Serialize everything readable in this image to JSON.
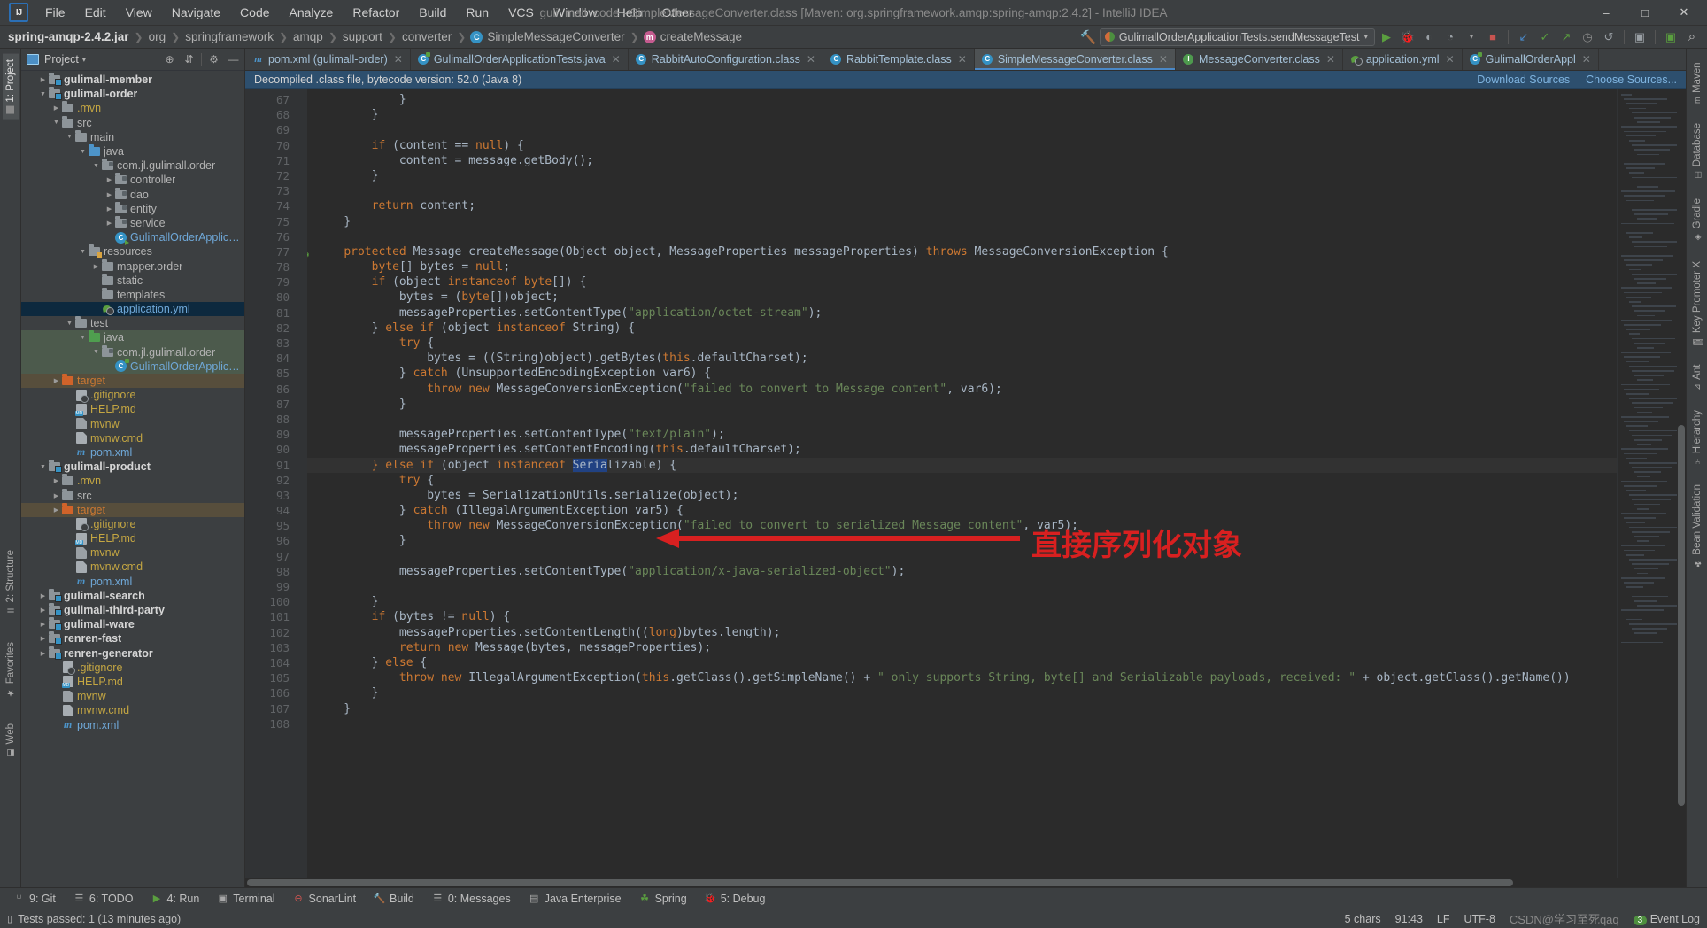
{
  "window": {
    "title": "guli_mall_code - SimpleMessageConverter.class [Maven: org.springframework.amqp:spring-amqp:2.4.2] - IntelliJ IDEA",
    "logo": "IJ",
    "minimize": "–",
    "maximize": "□",
    "close": "✕"
  },
  "menu": [
    {
      "label": "File"
    },
    {
      "label": "Edit"
    },
    {
      "label": "View"
    },
    {
      "label": "Navigate"
    },
    {
      "label": "Code"
    },
    {
      "label": "Analyze"
    },
    {
      "label": "Refactor"
    },
    {
      "label": "Build"
    },
    {
      "label": "Run"
    },
    {
      "label": "VCS"
    },
    {
      "label": "Window"
    },
    {
      "label": "Help"
    },
    {
      "label": "Other"
    }
  ],
  "breadcrumb": [
    {
      "label": "spring-amqp-2.4.2.jar",
      "bold": true,
      "icon": ""
    },
    {
      "label": "org",
      "bold": false,
      "icon": ""
    },
    {
      "label": "springframework",
      "bold": false,
      "icon": ""
    },
    {
      "label": "amqp",
      "bold": false,
      "icon": ""
    },
    {
      "label": "support",
      "bold": false,
      "icon": ""
    },
    {
      "label": "converter",
      "bold": false,
      "icon": ""
    },
    {
      "label": "SimpleMessageConverter",
      "bold": false,
      "icon": "class-icon"
    },
    {
      "label": "createMessage",
      "bold": false,
      "icon": "method-icon"
    }
  ],
  "run_config": {
    "name": "GulimallOrderApplicationTests.sendMessageTest",
    "dropdown_caret": "▾"
  },
  "toolbar_icons": [
    {
      "name": "run-icon",
      "glyph": "▶",
      "color": "#5a9e3f"
    },
    {
      "name": "debug-icon",
      "glyph": "🐞",
      "color": "#5a9e3f"
    },
    {
      "name": "run-with-coverage-icon",
      "glyph": "◐",
      "color": "#9aa0a5"
    },
    {
      "name": "profiler-icon",
      "glyph": "◔",
      "color": "#9aa0a5"
    },
    {
      "name": "stop-icon",
      "glyph": "■",
      "color": "#c75450"
    },
    {
      "name": "step-into-icon",
      "glyph": "↙",
      "color": "#4a88c7"
    },
    {
      "name": "check-icon",
      "glyph": "✓",
      "color": "#5a9e3f"
    },
    {
      "name": "step-out-icon",
      "glyph": "↗",
      "color": "#5a9e3f"
    },
    {
      "name": "history-icon",
      "glyph": "◷",
      "color": "#8b8b8b"
    },
    {
      "name": "undo-icon",
      "glyph": "↺",
      "color": "#9aa0a5"
    },
    {
      "name": "project-structure-icon",
      "glyph": "▣",
      "color": "#9aa0a5"
    },
    {
      "name": "terminal-icon",
      "glyph": "▣",
      "color": "#5a9e3f"
    },
    {
      "name": "search-everywhere-icon",
      "glyph": "⌕",
      "color": "#bbbbbb"
    }
  ],
  "left_strip": {
    "tabs": [
      {
        "label": "1: Project",
        "active": true
      },
      {
        "label": "2: Structure",
        "active": false
      },
      {
        "label": "Favorites",
        "active": false
      },
      {
        "label": "Web",
        "active": false
      }
    ]
  },
  "right_strip": {
    "tabs": [
      {
        "label": "Maven"
      },
      {
        "label": "Database"
      },
      {
        "label": "Gradle"
      },
      {
        "label": "Key Promoter X"
      },
      {
        "label": "Ant"
      },
      {
        "label": "Hierarchy"
      },
      {
        "label": "Bean Validation"
      }
    ]
  },
  "project_panel": {
    "title": "Project",
    "caret": "▾",
    "actions": [
      {
        "name": "locate-icon",
        "glyph": "⊕"
      },
      {
        "name": "collapse-all-icon",
        "glyph": "⇵"
      },
      {
        "name": "settings-icon",
        "glyph": "⚙"
      },
      {
        "name": "hide-icon",
        "glyph": "—"
      }
    ],
    "tree": [
      {
        "depth": 1,
        "arrow": "▶",
        "icon": "module-folder",
        "label": "gulimall-member",
        "style": "bold",
        "row": ""
      },
      {
        "depth": 1,
        "arrow": "▼",
        "icon": "module-folder",
        "label": "gulimall-order",
        "style": "bold",
        "row": ""
      },
      {
        "depth": 2,
        "arrow": "▶",
        "icon": "folder-grey",
        "label": ".mvn",
        "style": "yellow",
        "row": ""
      },
      {
        "depth": 2,
        "arrow": "▼",
        "icon": "folder-grey",
        "label": "src",
        "style": "grey",
        "row": ""
      },
      {
        "depth": 3,
        "arrow": "▼",
        "icon": "folder-grey",
        "label": "main",
        "style": "grey",
        "row": ""
      },
      {
        "depth": 4,
        "arrow": "▼",
        "icon": "folder-blue",
        "label": "java",
        "style": "grey",
        "row": ""
      },
      {
        "depth": 5,
        "arrow": "▼",
        "icon": "folder-package",
        "label": "com.jl.gulimall.order",
        "style": "grey",
        "row": ""
      },
      {
        "depth": 6,
        "arrow": "▶",
        "icon": "folder-package",
        "label": "controller",
        "style": "grey",
        "row": ""
      },
      {
        "depth": 6,
        "arrow": "▶",
        "icon": "folder-package",
        "label": "dao",
        "style": "grey",
        "row": ""
      },
      {
        "depth": 6,
        "arrow": "▶",
        "icon": "folder-package",
        "label": "entity",
        "style": "grey",
        "row": ""
      },
      {
        "depth": 6,
        "arrow": "▶",
        "icon": "folder-package",
        "label": "service",
        "style": "grey",
        "row": ""
      },
      {
        "depth": 6,
        "arrow": "",
        "icon": "class-run",
        "label": "GulimallOrderApplication",
        "style": "blue",
        "row": ""
      },
      {
        "depth": 4,
        "arrow": "▼",
        "icon": "folder-resources",
        "label": "resources",
        "style": "grey",
        "row": ""
      },
      {
        "depth": 5,
        "arrow": "▶",
        "icon": "folder-grey",
        "label": "mapper.order",
        "style": "grey",
        "row": ""
      },
      {
        "depth": 5,
        "arrow": "",
        "icon": "folder-grey",
        "label": "static",
        "style": "grey",
        "row": ""
      },
      {
        "depth": 5,
        "arrow": "",
        "icon": "folder-grey",
        "label": "templates",
        "style": "grey",
        "row": ""
      },
      {
        "depth": 5,
        "arrow": "",
        "icon": "yml",
        "label": "application.yml",
        "style": "blue",
        "row": "sel-blue"
      },
      {
        "depth": 3,
        "arrow": "▼",
        "icon": "folder-grey",
        "label": "test",
        "style": "grey",
        "row": ""
      },
      {
        "depth": 4,
        "arrow": "▼",
        "icon": "folder-green",
        "label": "java",
        "style": "grey",
        "row": "sel-green"
      },
      {
        "depth": 5,
        "arrow": "▼",
        "icon": "folder-package",
        "label": "com.jl.gulimall.order",
        "style": "grey",
        "row": "sel-green"
      },
      {
        "depth": 6,
        "arrow": "",
        "icon": "class-test",
        "label": "GulimallOrderApplication",
        "style": "blue",
        "row": "sel-green"
      },
      {
        "depth": 2,
        "arrow": "▶",
        "icon": "folder-orange",
        "label": "target",
        "style": "orange",
        "row": "sel-brown"
      },
      {
        "depth": 3,
        "arrow": "",
        "icon": "gitignore",
        "label": ".gitignore",
        "style": "yellow",
        "row": ""
      },
      {
        "depth": 3,
        "arrow": "",
        "icon": "md",
        "label": "HELP.md",
        "style": "yellow",
        "row": ""
      },
      {
        "depth": 3,
        "arrow": "",
        "icon": "script",
        "label": "mvnw",
        "style": "yellow",
        "row": ""
      },
      {
        "depth": 3,
        "arrow": "",
        "icon": "file",
        "label": "mvnw.cmd",
        "style": "yellow",
        "row": ""
      },
      {
        "depth": 3,
        "arrow": "",
        "icon": "maven",
        "label": "pom.xml",
        "style": "blue",
        "row": ""
      },
      {
        "depth": 1,
        "arrow": "▼",
        "icon": "module-folder",
        "label": "gulimall-product",
        "style": "bold",
        "row": ""
      },
      {
        "depth": 2,
        "arrow": "▶",
        "icon": "folder-grey",
        "label": ".mvn",
        "style": "yellow",
        "row": ""
      },
      {
        "depth": 2,
        "arrow": "▶",
        "icon": "folder-grey",
        "label": "src",
        "style": "grey",
        "row": ""
      },
      {
        "depth": 2,
        "arrow": "▶",
        "icon": "folder-orange",
        "label": "target",
        "style": "orange",
        "row": "sel-brown"
      },
      {
        "depth": 3,
        "arrow": "",
        "icon": "gitignore",
        "label": ".gitignore",
        "style": "yellow",
        "row": ""
      },
      {
        "depth": 3,
        "arrow": "",
        "icon": "md",
        "label": "HELP.md",
        "style": "yellow",
        "row": ""
      },
      {
        "depth": 3,
        "arrow": "",
        "icon": "script",
        "label": "mvnw",
        "style": "yellow",
        "row": ""
      },
      {
        "depth": 3,
        "arrow": "",
        "icon": "file",
        "label": "mvnw.cmd",
        "style": "yellow",
        "row": ""
      },
      {
        "depth": 3,
        "arrow": "",
        "icon": "maven",
        "label": "pom.xml",
        "style": "blue",
        "row": ""
      },
      {
        "depth": 1,
        "arrow": "▶",
        "icon": "module-folder",
        "label": "gulimall-search",
        "style": "bold",
        "row": ""
      },
      {
        "depth": 1,
        "arrow": "▶",
        "icon": "module-folder",
        "label": "gulimall-third-party",
        "style": "bold",
        "row": ""
      },
      {
        "depth": 1,
        "arrow": "▶",
        "icon": "module-folder",
        "label": "gulimall-ware",
        "style": "bold",
        "row": ""
      },
      {
        "depth": 1,
        "arrow": "▶",
        "icon": "module-folder",
        "label": "renren-fast",
        "style": "bold",
        "row": ""
      },
      {
        "depth": 1,
        "arrow": "▶",
        "icon": "module-folder",
        "label": "renren-generator",
        "style": "bold",
        "row": ""
      },
      {
        "depth": 2,
        "arrow": "",
        "icon": "gitignore",
        "label": ".gitignore",
        "style": "yellow",
        "row": ""
      },
      {
        "depth": 2,
        "arrow": "",
        "icon": "md",
        "label": "HELP.md",
        "style": "yellow",
        "row": ""
      },
      {
        "depth": 2,
        "arrow": "",
        "icon": "script",
        "label": "mvnw",
        "style": "yellow",
        "row": ""
      },
      {
        "depth": 2,
        "arrow": "",
        "icon": "file",
        "label": "mvnw.cmd",
        "style": "yellow",
        "row": ""
      },
      {
        "depth": 2,
        "arrow": "",
        "icon": "maven",
        "label": "pom.xml",
        "style": "blue",
        "row": ""
      }
    ]
  },
  "editor": {
    "tabs": [
      {
        "label": "pom.xml (gulimall-order)",
        "icon": "maven-icon",
        "active": false
      },
      {
        "label": "GulimallOrderApplicationTests.java",
        "icon": "test-class-icon",
        "active": false
      },
      {
        "label": "RabbitAutoConfiguration.class",
        "icon": "class-icon",
        "active": false
      },
      {
        "label": "RabbitTemplate.class",
        "icon": "class-icon",
        "active": false
      },
      {
        "label": "SimpleMessageConverter.class",
        "icon": "class-icon",
        "active": true
      },
      {
        "label": "MessageConverter.class",
        "icon": "interface-icon",
        "active": false
      },
      {
        "label": "application.yml",
        "icon": "yml-icon",
        "active": false
      },
      {
        "label": "GulimallOrderAppl",
        "icon": "test-class-icon",
        "active": false
      }
    ],
    "notice": {
      "text": "Decompiled .class file, bytecode version: 52.0 (Java 8)",
      "download_sources": "Download Sources",
      "choose_sources": "Choose Sources..."
    },
    "annotation": {
      "text": "直接序列化对象",
      "color": "#d82020"
    },
    "first_line_number": 67,
    "lines": [
      {
        "num": 67,
        "fold": "−",
        "text": "            }"
      },
      {
        "num": 68,
        "fold": "−",
        "text": "        }"
      },
      {
        "num": 69,
        "fold": "",
        "text": ""
      },
      {
        "num": 70,
        "fold": "−",
        "text": "        if (content == null) {"
      },
      {
        "num": 71,
        "fold": "",
        "text": "            content = message.getBody();"
      },
      {
        "num": 72,
        "fold": "−",
        "text": "        }"
      },
      {
        "num": 73,
        "fold": "",
        "text": ""
      },
      {
        "num": 74,
        "fold": "",
        "text": "        return content;"
      },
      {
        "num": 75,
        "fold": "−",
        "text": "    }"
      },
      {
        "num": 76,
        "fold": "",
        "text": ""
      },
      {
        "num": 77,
        "fold": "−",
        "text": "    protected Message createMessage(Object object, MessageProperties messageProperties) throws MessageConversionException {"
      },
      {
        "num": 78,
        "fold": "",
        "text": "        byte[] bytes = null;"
      },
      {
        "num": 79,
        "fold": "−",
        "text": "        if (object instanceof byte[]) {"
      },
      {
        "num": 80,
        "fold": "",
        "text": "            bytes = (byte[])object;"
      },
      {
        "num": 81,
        "fold": "",
        "text": "            messageProperties.setContentType(\"application/octet-stream\");"
      },
      {
        "num": 82,
        "fold": "−",
        "text": "        } else if (object instanceof String) {"
      },
      {
        "num": 83,
        "fold": "−",
        "text": "            try {"
      },
      {
        "num": 84,
        "fold": "",
        "text": "                bytes = ((String)object).getBytes(this.defaultCharset);"
      },
      {
        "num": 85,
        "fold": "−",
        "text": "            } catch (UnsupportedEncodingException var6) {"
      },
      {
        "num": 86,
        "fold": "",
        "text": "                throw new MessageConversionException(\"failed to convert to Message content\", var6);"
      },
      {
        "num": 87,
        "fold": "",
        "text": "            }"
      },
      {
        "num": 88,
        "fold": "",
        "text": ""
      },
      {
        "num": 89,
        "fold": "",
        "text": "            messageProperties.setContentType(\"text/plain\");"
      },
      {
        "num": 90,
        "fold": "",
        "text": "            messageProperties.setContentEncoding(this.defaultCharset);"
      },
      {
        "num": 91,
        "fold": "−",
        "text": "        } else if (object instanceof Serializable) {"
      },
      {
        "num": 92,
        "fold": "−",
        "text": "            try {"
      },
      {
        "num": 93,
        "fold": "",
        "text": "                bytes = SerializationUtils.serialize(object);"
      },
      {
        "num": 94,
        "fold": "−",
        "text": "            } catch (IllegalArgumentException var5) {"
      },
      {
        "num": 95,
        "fold": "",
        "text": "                throw new MessageConversionException(\"failed to convert to serialized Message content\", var5);"
      },
      {
        "num": 96,
        "fold": "",
        "text": "            }"
      },
      {
        "num": 97,
        "fold": "",
        "text": ""
      },
      {
        "num": 98,
        "fold": "",
        "text": "            messageProperties.setContentType(\"application/x-java-serialized-object\");"
      },
      {
        "num": 99,
        "fold": "",
        "text": ""
      },
      {
        "num": 100,
        "fold": "",
        "text": "        }"
      },
      {
        "num": 101,
        "fold": "−",
        "text": "        if (bytes != null) {"
      },
      {
        "num": 102,
        "fold": "",
        "text": "            messageProperties.setContentLength((long)bytes.length);"
      },
      {
        "num": 103,
        "fold": "",
        "text": "            return new Message(bytes, messageProperties);"
      },
      {
        "num": 104,
        "fold": "−",
        "text": "        } else {"
      },
      {
        "num": 105,
        "fold": "",
        "text": "            throw new IllegalArgumentException(this.getClass().getSimpleName() + \" only supports String, byte[] and Serializable payloads, received: \" + object.getClass().getName())"
      },
      {
        "num": 106,
        "fold": "",
        "text": "        }"
      },
      {
        "num": 107,
        "fold": "",
        "text": "    }"
      },
      {
        "num": 108,
        "fold": "",
        "text": ""
      }
    ]
  },
  "bottom_tools": [
    {
      "label": "9: Git",
      "icon": "git-icon",
      "underline": "9"
    },
    {
      "label": "6: TODO",
      "icon": "todo-icon",
      "underline": "6"
    },
    {
      "label": "4: Run",
      "icon": "run-icon",
      "underline": "4"
    },
    {
      "label": "Terminal",
      "icon": "terminal-icon",
      "underline": ""
    },
    {
      "label": "SonarLint",
      "icon": "sonarlint-icon",
      "underline": ""
    },
    {
      "label": "Build",
      "icon": "build-icon",
      "underline": ""
    },
    {
      "label": "0: Messages",
      "icon": "messages-icon",
      "underline": "0"
    },
    {
      "label": "Java Enterprise",
      "icon": "java-enterprise-icon",
      "underline": ""
    },
    {
      "label": "Spring",
      "icon": "spring-icon",
      "underline": ""
    },
    {
      "label": "5: Debug",
      "icon": "debug-icon",
      "underline": "5"
    }
  ],
  "statusbar": {
    "message": "Tests passed: 1 (13 minutes ago)",
    "chars": "5 chars",
    "caret": "91:43",
    "line_sep": "LF",
    "encoding": "UTF-8",
    "event_log": "Event Log",
    "event_count": "3",
    "watermark": "CSDN@学习至死qaq"
  }
}
